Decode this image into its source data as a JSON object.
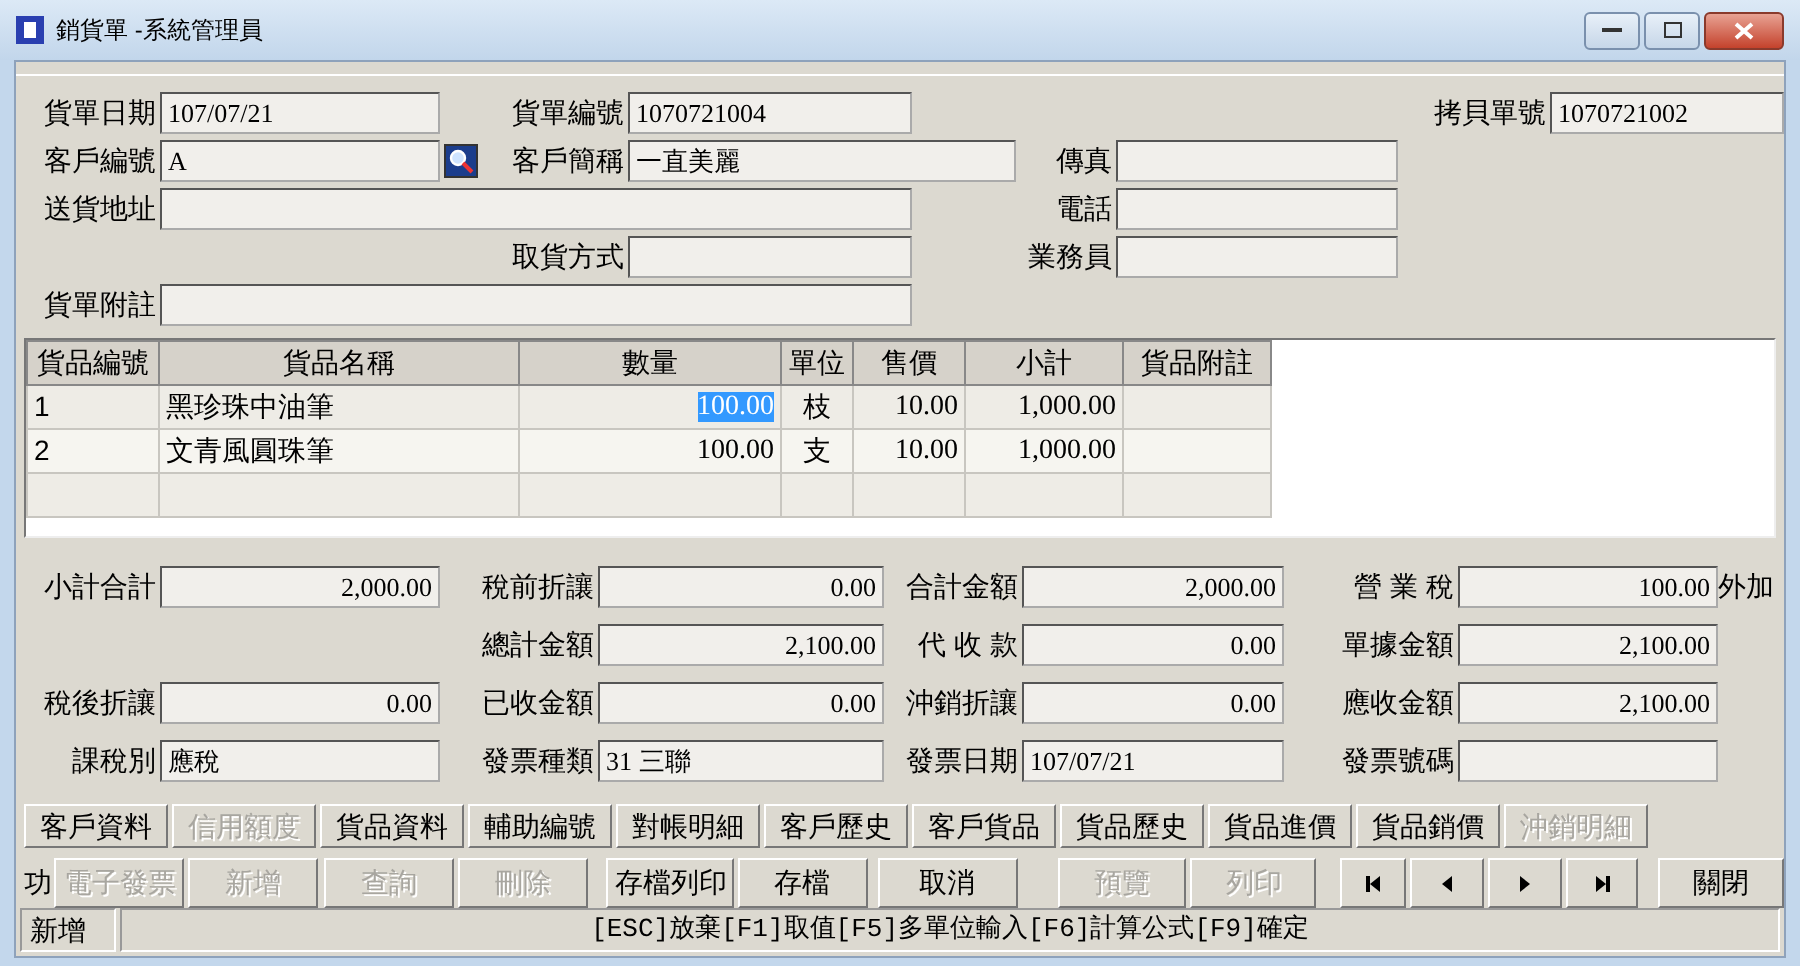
{
  "window": {
    "title": "銷貨單 -系統管理員"
  },
  "header": {
    "fields": [
      {
        "label": "貨單日期",
        "value": "107/07/21",
        "kind": "text"
      },
      {
        "label": "貨單編號",
        "value": "1070721004",
        "kind": "text"
      },
      {
        "label": "拷貝單號",
        "value": "1070721002",
        "kind": "text"
      },
      {
        "label": "客戶編號",
        "value": "A",
        "kind": "lookup"
      },
      {
        "label": "客戶簡稱",
        "value": "一直美麗",
        "kind": "text"
      },
      {
        "label": "傳真",
        "kind": "text"
      },
      {
        "label": "送貨地址",
        "kind": "text"
      },
      {
        "label": "電話",
        "kind": "text"
      },
      {
        "label": "取貨方式",
        "kind": "text"
      },
      {
        "label": "業務員",
        "kind": "text"
      },
      {
        "label": "貨單附註",
        "kind": "text"
      }
    ]
  },
  "table": {
    "columns": [
      "貨品編號",
      "貨品名稱",
      "數量",
      "單位",
      "售價",
      "小計",
      "貨品附註"
    ],
    "rows": [
      {
        "cells": [
          "1",
          "黑珍珠中油筆",
          "100.00",
          "枝",
          "10.00",
          "1,000.00"
        ],
        "selected": true
      },
      {
        "cells": [
          "2",
          "文青風圓珠筆",
          "100.00",
          "支",
          "10.00",
          "1,000.00"
        ],
        "selected": false
      }
    ]
  },
  "totals": {
    "fields": [
      {
        "label": "小計合計",
        "value": "2,000.00",
        "kind": "amount"
      },
      {
        "label": "稅前折讓",
        "value": "0.00",
        "kind": "amount"
      },
      {
        "label": "合計金額",
        "value": "2,000.00",
        "kind": "amount"
      },
      {
        "label": "營 業 稅",
        "value": "100.00",
        "kind": "amount",
        "suffix": "外加"
      },
      {
        "label": "總計金額",
        "value": "2,100.00",
        "kind": "amount"
      },
      {
        "label": "代 收 款",
        "value": "0.00",
        "kind": "amount"
      },
      {
        "label": "單據金額",
        "value": "2,100.00",
        "kind": "amount"
      },
      {
        "label": "稅後折讓",
        "value": "0.00",
        "kind": "amount"
      },
      {
        "label": "已收金額",
        "value": "0.00",
        "kind": "amount"
      },
      {
        "label": "沖銷折讓",
        "value": "0.00",
        "kind": "amount"
      },
      {
        "label": "應收金額",
        "value": "2,100.00",
        "kind": "amount"
      },
      {
        "label": "課稅別",
        "value": "應稅",
        "kind": "text"
      },
      {
        "label": "發票種類",
        "value": "31 三聯",
        "kind": "text"
      },
      {
        "label": "發票日期",
        "value": "107/07/21",
        "kind": "text"
      },
      {
        "label": "發票號碼",
        "kind": "text"
      }
    ]
  },
  "function_tabs": [
    {
      "label": "客戶資料",
      "disabled": false
    },
    {
      "label": "信用額度",
      "disabled": true
    },
    {
      "label": "貨品資料",
      "disabled": false
    },
    {
      "label": "輔助編號",
      "disabled": false
    },
    {
      "label": "對帳明細",
      "disabled": false
    },
    {
      "label": "客戶歷史",
      "disabled": false
    },
    {
      "label": "客戶貨品",
      "disabled": false
    },
    {
      "label": "貨品歷史",
      "disabled": false
    },
    {
      "label": "貨品進價",
      "disabled": false
    },
    {
      "label": "貨品銷價",
      "disabled": false
    },
    {
      "label": "沖銷明細",
      "disabled": true
    }
  ],
  "actions": {
    "label": "功",
    "buttons": [
      {
        "kind": "text",
        "label": "電子發票",
        "disabled": true
      },
      {
        "kind": "text",
        "label": "新增",
        "disabled": true
      },
      {
        "kind": "text",
        "label": "查詢",
        "disabled": true
      },
      {
        "kind": "text",
        "label": "刪除",
        "disabled": true
      },
      {
        "kind": "text",
        "label": "存檔列印",
        "disabled": false
      },
      {
        "kind": "text",
        "label": "存檔",
        "disabled": false
      },
      {
        "kind": "text",
        "label": "取消",
        "disabled": false
      },
      {
        "kind": "text",
        "label": "預覽",
        "disabled": true
      },
      {
        "kind": "text",
        "label": "列印",
        "disabled": true
      },
      {
        "kind": "first",
        "disabled": false
      },
      {
        "kind": "prev",
        "disabled": false
      },
      {
        "kind": "next",
        "disabled": false
      },
      {
        "kind": "last",
        "disabled": false
      },
      {
        "kind": "text",
        "label": "關閉",
        "disabled": false
      }
    ]
  },
  "status_bar": {
    "mode": "新增",
    "message": "[ESC]放棄[F1]取值[F5]多單位輸入[F6]計算公式[F9]確定"
  }
}
